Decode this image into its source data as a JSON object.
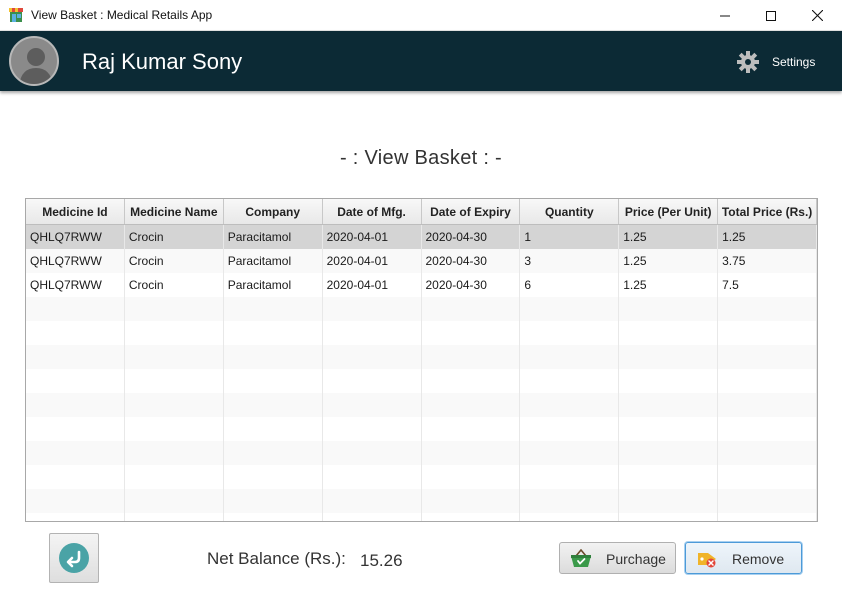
{
  "window": {
    "title": "View Basket : Medical Retails App",
    "minimize_glyph": "—",
    "maximize_glyph": "☐",
    "close_glyph": "✕"
  },
  "header": {
    "user_name": "Raj Kumar Sony",
    "settings_label": "Settings",
    "background": "#0c2a35"
  },
  "page": {
    "title": "- : View  Basket : -"
  },
  "table": {
    "columns": [
      "Medicine Id",
      "Medicine Name",
      "Company",
      "Date of Mfg.",
      "Date of Expiry",
      "Quantity",
      "Price (Per Unit)",
      "Total Price (Rs.)"
    ],
    "rows": [
      [
        "QHLQ7RWW",
        "Crocin",
        "Paracitamol",
        "2020-04-01",
        "2020-04-30",
        "1",
        "1.25",
        "1.25"
      ],
      [
        "QHLQ7RWW",
        "Crocin",
        "Paracitamol",
        "2020-04-01",
        "2020-04-30",
        "3",
        "1.25",
        "3.75"
      ],
      [
        "QHLQ7RWW",
        "Crocin",
        "Paracitamol",
        "2020-04-01",
        "2020-04-30",
        "6",
        "1.25",
        "7.5"
      ]
    ],
    "selected_row": 0
  },
  "footer": {
    "net_balance_label": "Net Balance (Rs.):",
    "net_balance_value": "15.26",
    "purchase_label": "Purchage",
    "remove_label": "Remove"
  },
  "icons": {
    "app": "medical-store-icon",
    "avatar": "user-avatar-icon",
    "settings": "gear-icon",
    "back": "back-arrow-icon",
    "purchase": "basket-icon",
    "remove": "remove-tag-icon"
  },
  "colors": {
    "accent_teal": "#4aa3a6",
    "remove_border": "#4c9ad8"
  }
}
